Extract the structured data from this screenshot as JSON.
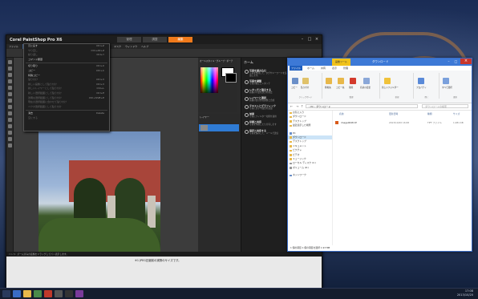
{
  "psp": {
    "title": "Corel PaintShop Pro X6",
    "tabs": [
      "管理",
      "調整",
      "編集"
    ],
    "menus": [
      "ファイル",
      "編集",
      "表示",
      "画像",
      "調整",
      "効果",
      "レイヤー",
      "オブジェクト",
      "選択範囲",
      "マスク",
      "ウィンドウ",
      "ヘルプ"
    ],
    "edit_menu": [
      {
        "label": "元に戻す",
        "shortcut": "Ctrl+Z"
      },
      {
        "label": "やり直し",
        "shortcut": "Ctrl+Alt+Z"
      },
      {
        "label": "繰り返し",
        "shortcut": "Ctrl+Y"
      },
      {
        "label": "コマンド履歴",
        "shortcut": ""
      },
      {
        "label": "切り取り",
        "shortcut": "Ctrl+X"
      },
      {
        "label": "コピー",
        "shortcut": "Ctrl+C"
      },
      {
        "label": "特殊コピー",
        "shortcut": ""
      },
      {
        "label": "貼り付け",
        "shortcut": "Ctrl+V"
      },
      {
        "label": "新しい画像として貼り付け",
        "shortcut": "Ctrl+V"
      },
      {
        "label": "新しいレイヤーとして貼り付け",
        "shortcut": "Ctrl+L"
      },
      {
        "label": "新しい選択範囲として貼り付け",
        "shortcut": "Ctrl+E"
      },
      {
        "label": "透明な選択範囲として貼り付け",
        "shortcut": "Ctrl+Shift+E"
      },
      {
        "label": "現在の選択範囲に合わせて貼り付け",
        "shortcut": ""
      },
      {
        "label": "ベクタ選択範囲として貼り付け",
        "shortcut": ""
      },
      {
        "label": "消去",
        "shortcut": "Delete"
      },
      {
        "label": "空にする",
        "shortcut": ""
      }
    ],
    "materials_label": "オールスタイル・グループ・ポーチ",
    "layers_label": "レイヤー",
    "learn_center": {
      "title": "ホーム",
      "items": [
        {
          "title": "写真を読み込む",
          "desc": "写真を整理して、タグやキーワードを追加します。"
        },
        {
          "title": "写真を調整",
          "desc": "写真の補正とレタッチ"
        },
        {
          "title": "レタッチと復元する",
          "desc": "画像の不要な部分を除去"
        },
        {
          "title": "レイヤーと選択",
          "desc": "画像の部分的な調整と合成"
        },
        {
          "title": "テキストとグラフィック",
          "desc": "写真に文字や図形を追加"
        },
        {
          "title": "効果",
          "desc": "写真にフィルター効果を適用"
        },
        {
          "title": "印刷と共有",
          "desc": "写真を印刷したり共有します"
        },
        {
          "title": "保存と共有する",
          "desc": "写真を保存して、メールで送信"
        }
      ]
    },
    "status_text": "ハンド: ズーム済みの画像をドラッグしてパン表示します。",
    "bottom_note": "※1 JPEG圧縮前の実際のサイズです。"
  },
  "explorer": {
    "context_tab": "画像ツール",
    "title": "ダウンロード",
    "ribbon_tabs": [
      "ファイル",
      "ホーム",
      "共有",
      "表示",
      "管理"
    ],
    "ribbon_groups": [
      "クリップボード",
      "整理",
      "新規",
      "開く",
      "選択"
    ],
    "ribbon_buttons": [
      "コピー",
      "貼り付け",
      "移動先",
      "コピー先",
      "削除",
      "名前の変更",
      "新しいフォルダー",
      "プロパティ",
      "すべて選択"
    ],
    "address": "› PC › ダウンロード",
    "search_placeholder": "ダウンロードの検索",
    "nav_items": [
      "お気に入り",
      "ダウンロード",
      "デスクトップ",
      "最近表示した場所",
      "PC",
      "ダウンロード",
      "デスクトップ",
      "ドキュメント",
      "ピクチャ",
      "ビデオ",
      "ミュージック",
      "ローカル ディスク (C:)",
      "ボリューム (D:)",
      "ネットワーク"
    ],
    "columns": [
      "名前",
      "更新日時",
      "種類",
      "サイズ"
    ],
    "file": {
      "name": "image0048.tif",
      "date": "2013/10/20 16:08",
      "type": "TIFF ファイル",
      "size": "1,981 KB"
    },
    "status": "1 個の項目 1 個の項目を選択 1.93 MB"
  },
  "taskbar": {
    "time": "17:08",
    "date": "2013/10/20"
  }
}
